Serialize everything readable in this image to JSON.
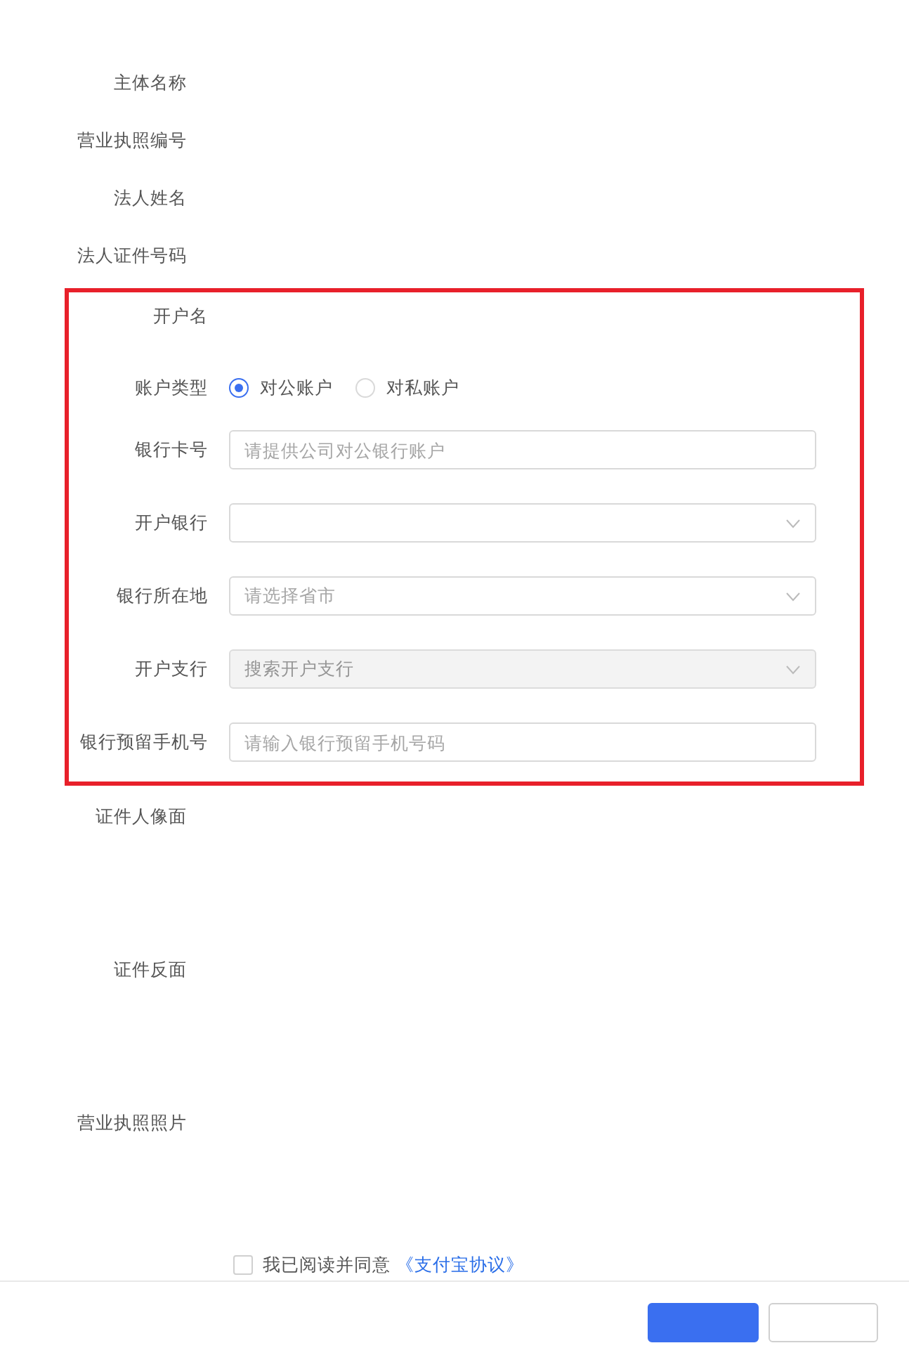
{
  "basic_fields": [
    {
      "label": "主体名称"
    },
    {
      "label": "营业执照编号"
    },
    {
      "label": "法人姓名"
    },
    {
      "label": "法人证件号码"
    }
  ],
  "account_section": {
    "fields": [
      {
        "kind": "text",
        "label": "开户名"
      },
      {
        "kind": "radio",
        "label": "账户类型",
        "options": [
          {
            "label": "对公账户",
            "selected": true
          },
          {
            "label": "对私账户",
            "selected": false
          }
        ]
      },
      {
        "kind": "input",
        "label": "银行卡号",
        "placeholder": "请提供公司对公银行账户"
      },
      {
        "kind": "select",
        "label": "开户银行",
        "disabled": false
      },
      {
        "kind": "select",
        "label": "银行所在地",
        "placeholder": "请选择省市",
        "disabled": false
      },
      {
        "kind": "select",
        "label": "开户支行",
        "placeholder": "搜索开户支行",
        "disabled": true
      },
      {
        "kind": "input",
        "label": "银行预留手机号",
        "placeholder": "请输入银行预留手机号码"
      }
    ]
  },
  "uploads": [
    {
      "label": "证件人像面"
    },
    {
      "label": "证件反面"
    },
    {
      "label": "营业执照照片"
    }
  ],
  "agreement": {
    "checked": false,
    "text": "我已阅读并同意",
    "link": "《支付宝协议》"
  },
  "footer": {
    "buttons": [
      {
        "kind": "primary"
      },
      {
        "kind": "default"
      }
    ]
  }
}
